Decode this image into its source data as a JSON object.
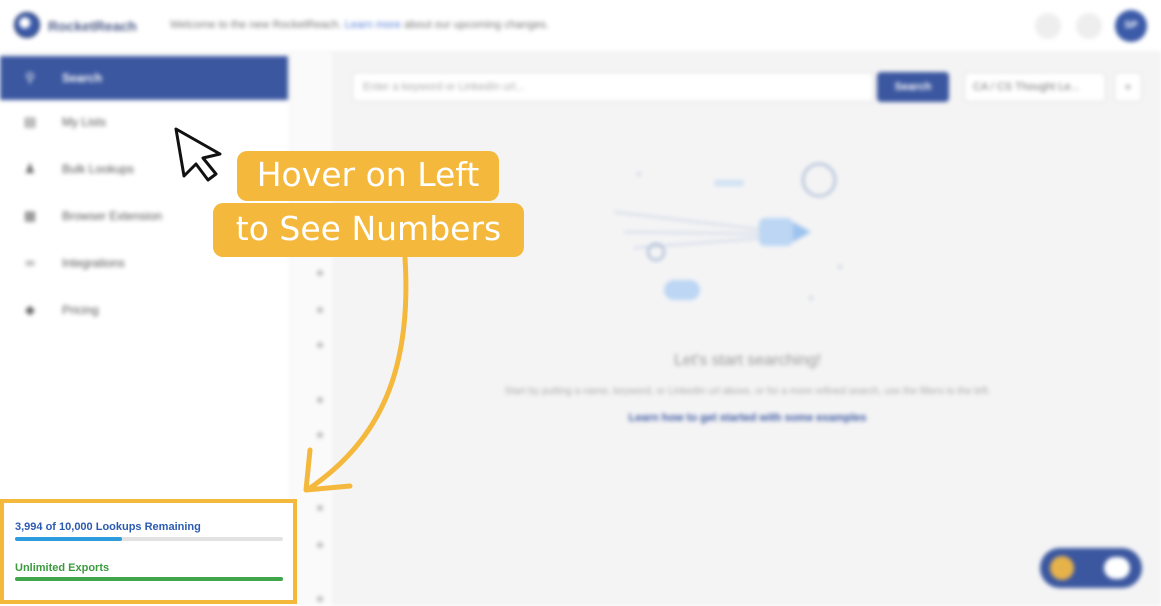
{
  "topbar": {
    "brand": "RocketReach",
    "banner_text": "Welcome to the new RocketReach.",
    "banner_link": "Learn more",
    "banner_suffix": "about our upcoming changes.",
    "avatar_initials": "SP"
  },
  "sidebar": {
    "items": [
      {
        "label": "Search",
        "icon": "search-icon",
        "active": true
      },
      {
        "label": "My Lists",
        "icon": "list-icon",
        "active": false
      },
      {
        "label": "Bulk Lookups",
        "icon": "person-icon",
        "active": false
      },
      {
        "label": "Browser Extension",
        "icon": "extension-icon",
        "active": false
      },
      {
        "label": "Integrations",
        "icon": "link-icon",
        "active": false
      },
      {
        "label": "Pricing",
        "icon": "tag-icon",
        "active": false
      }
    ]
  },
  "search": {
    "placeholder": "Enter a keyword or LinkedIn url...",
    "button_label": "Search",
    "filter_value": "CA / CS Thought Le...",
    "more_label": "+"
  },
  "empty_state": {
    "title": "Let's start searching!",
    "subtitle": "Start by putting a name, keyword, or LinkedIn url above, or for a more refined search, use the filters to the left.",
    "link": "Learn how to get started with some examples"
  },
  "overlay": {
    "callout_line1": "Hover on Left",
    "callout_line2": "to See Numbers"
  },
  "quota": {
    "lookups_label": "3,994 of 10,000 Lookups Remaining",
    "lookups_remaining": 3994,
    "lookups_total": 10000,
    "lookups_bar_fraction": 0.4,
    "exports_label": "Unlimited Exports",
    "exports_bar_fraction": 1.0
  },
  "colors": {
    "brand_blue": "#3b57a0",
    "callout_yellow": "#f4b93c",
    "lookups_blue": "#2e9bdc",
    "exports_green": "#3fa74a"
  }
}
